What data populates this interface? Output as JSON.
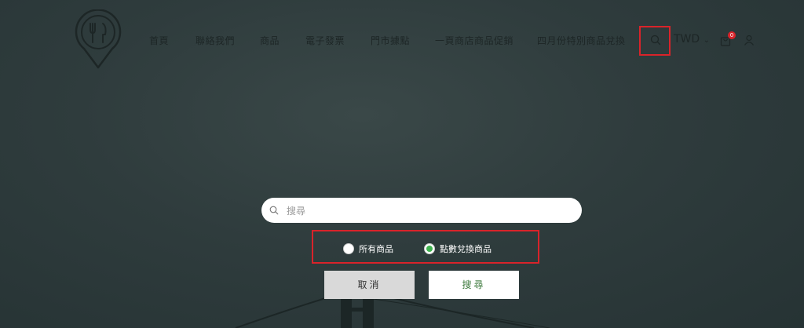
{
  "nav": {
    "items": [
      {
        "label": "首頁"
      },
      {
        "label": "聯絡我們"
      },
      {
        "label": "商品"
      },
      {
        "label": "電子發票"
      },
      {
        "label": "門市據點"
      },
      {
        "label": "一頁商店商品促銷"
      },
      {
        "label": "四月份特別商品兌換"
      }
    ],
    "currency": "TWD",
    "cart_count": "0"
  },
  "search": {
    "placeholder": "搜尋",
    "value": ""
  },
  "filters": {
    "options": [
      {
        "label": "所有商品",
        "selected": false
      },
      {
        "label": "點數兌換商品",
        "selected": true
      }
    ]
  },
  "actions": {
    "cancel_label": "取消",
    "search_label": "搜尋"
  },
  "icons": {
    "logo": "fork-knife-pin-icon",
    "search": "search-icon",
    "cart": "shopping-bag-icon",
    "account": "user-icon"
  },
  "colors": {
    "highlight": "#d9232a",
    "selected_radio": "#3fb34f",
    "overlay": "#2f3c3d"
  }
}
